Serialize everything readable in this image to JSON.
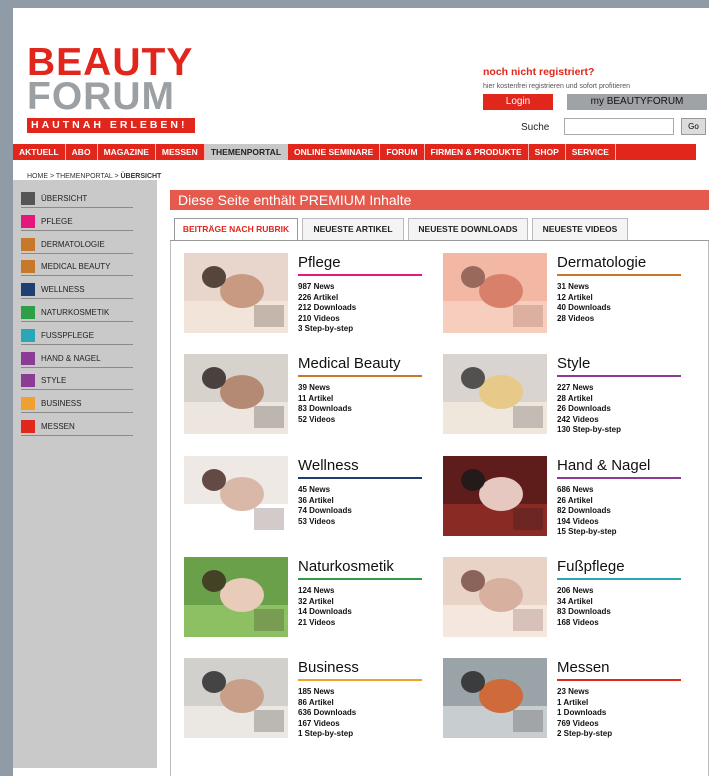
{
  "logo": {
    "line1": "BEAUTY",
    "line2": "FORUM",
    "slogan": "HAUTNAH ERLEBEN!"
  },
  "register": {
    "title": "noch nicht registriert?",
    "subtitle": "hier kostenfrei registrieren und sofort profitieren",
    "login_label": "Login",
    "my_label": "my BEAUTYFORUM",
    "search_label": "Suche",
    "search_value": "",
    "go_label": "Go"
  },
  "nav": {
    "items": [
      "AKTUELL",
      "ABO",
      "MAGAZINE",
      "MESSEN",
      "THEMENPORTAL",
      "ONLINE SEMINARE",
      "FORUM",
      "FIRMEN & PRODUKTE",
      "SHOP",
      "SERVICE"
    ],
    "active": "THEMENPORTAL"
  },
  "breadcrumb": {
    "path": "HOME > THEMENPORTAL > ",
    "current": "ÜBERSICHT"
  },
  "sidebar": {
    "items": [
      {
        "label": "ÜBERSICHT",
        "color": "#555555"
      },
      {
        "label": "PFLEGE",
        "color": "#e5177b"
      },
      {
        "label": "DERMATOLOGIE",
        "color": "#c8782a"
      },
      {
        "label": "MEDICAL BEAUTY",
        "color": "#c8782a"
      },
      {
        "label": "WELLNESS",
        "color": "#1f3f73"
      },
      {
        "label": "NATURKOSMETIK",
        "color": "#2e9e48"
      },
      {
        "label": "FUSSPFLEGE",
        "color": "#2aa7b5"
      },
      {
        "label": "HAND & NAGEL",
        "color": "#8b3a96"
      },
      {
        "label": "STYLE",
        "color": "#8b3a96"
      },
      {
        "label": "BUSINESS",
        "color": "#f0a030"
      },
      {
        "label": "MESSEN",
        "color": "#e1261c"
      }
    ]
  },
  "premium_banner": "Diese Seite enthält PREMIUM Inhalte",
  "tabs": [
    "BEITRÄGE NACH RUBRIK",
    "NEUESTE ARTIKEL",
    "NEUESTE DOWNLOADS",
    "NEUESTE VIDEOS"
  ],
  "categories": [
    {
      "title": "Pflege",
      "color": "#e5177b",
      "stats": [
        "987 News",
        "226 Artikel",
        "212 Downloads",
        "210 Videos",
        "3 Step-by-step"
      ]
    },
    {
      "title": "Dermatologie",
      "color": "#c8782a",
      "stats": [
        "31 News",
        "12 Artikel",
        "40 Downloads",
        "28 Videos"
      ]
    },
    {
      "title": "Medical Beauty",
      "color": "#c8782a",
      "stats": [
        "39 News",
        "11 Artikel",
        "83 Downloads",
        "52 Videos"
      ]
    },
    {
      "title": "Style",
      "color": "#8b3a96",
      "stats": [
        "227 News",
        "28 Artikel",
        "26 Downloads",
        "242 Videos",
        "130 Step-by-step"
      ]
    },
    {
      "title": "Wellness",
      "color": "#1f3f73",
      "stats": [
        "45 News",
        "36 Artikel",
        "74 Downloads",
        "53 Videos"
      ]
    },
    {
      "title": "Hand & Nagel",
      "color": "#8b3a96",
      "stats": [
        "686 News",
        "26 Artikel",
        "82 Downloads",
        "194 Videos",
        "15 Step-by-step"
      ]
    },
    {
      "title": "Naturkosmetik",
      "color": "#2e9e48",
      "stats": [
        "124 News",
        "32 Artikel",
        "14 Downloads",
        "21 Videos"
      ]
    },
    {
      "title": "Fußpflege",
      "color": "#2aa7b5",
      "stats": [
        "206 News",
        "34 Artikel",
        "83 Downloads",
        "168 Videos"
      ]
    },
    {
      "title": "Business",
      "color": "#f0a030",
      "stats": [
        "185 News",
        "86 Artikel",
        "636 Downloads",
        "167 Videos",
        "1 Step-by-step"
      ]
    },
    {
      "title": "Messen",
      "color": "#e1261c",
      "stats": [
        "23 News",
        "1 Artikel",
        "1 Downloads",
        "769 Videos",
        "2 Step-by-step"
      ]
    }
  ]
}
